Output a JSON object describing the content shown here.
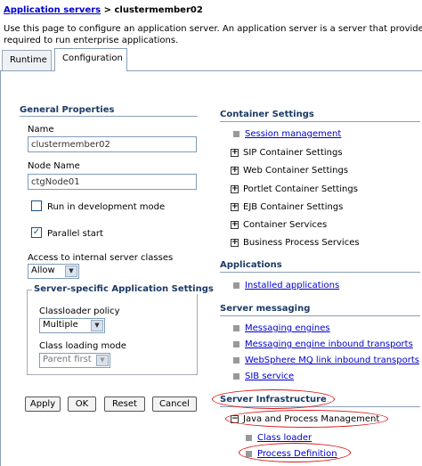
{
  "breadcrumb": {
    "parent": "Application servers",
    "separator": " > ",
    "current": "clustermember02"
  },
  "description": {
    "line1": "Use this page to configure an application server. An application server is a server that provides s",
    "line2": "required to run enterprise applications."
  },
  "tabs": {
    "runtime": "Runtime",
    "configuration": "Configuration"
  },
  "general": {
    "title": "General Properties",
    "name_label": "Name",
    "name_value": "clustermember02",
    "node_label": "Node Name",
    "node_value": "ctgNode01",
    "dev_mode_label": "Run in development mode",
    "dev_mode_checked": "",
    "parallel_label": "Parallel start",
    "parallel_checked": "✓",
    "access_label": "Access to internal server classes",
    "access_value": "Allow"
  },
  "server_specific": {
    "legend": "Server-specific Application Settings",
    "classloader_label": "Classloader policy",
    "classloader_value": "Multiple",
    "loading_mode_label": "Class loading mode",
    "loading_mode_value": "Parent first"
  },
  "buttons": {
    "apply": "Apply",
    "ok": "OK",
    "reset": "Reset",
    "cancel": "Cancel"
  },
  "container": {
    "title": "Container Settings",
    "items": [
      "Session management",
      "SIP Container Settings",
      "Web Container Settings",
      "Portlet Container Settings",
      "EJB Container Settings",
      "Container Services",
      "Business Process Services"
    ]
  },
  "applications": {
    "title": "Applications",
    "items": [
      "Installed applications"
    ]
  },
  "messaging": {
    "title": "Server messaging",
    "items": [
      "Messaging engines",
      "Messaging engine inbound transports",
      "WebSphere MQ link inbound transports",
      "SIB service"
    ]
  },
  "infrastructure": {
    "title": "Server Infrastructure",
    "expanded": "Java and Process Management",
    "items": [
      "Class loader",
      "Process Definition"
    ]
  },
  "colors": {
    "link": "#0000cc",
    "section": "#1a3a66",
    "highlight": "#d11111",
    "border": "#8aa0b8"
  }
}
